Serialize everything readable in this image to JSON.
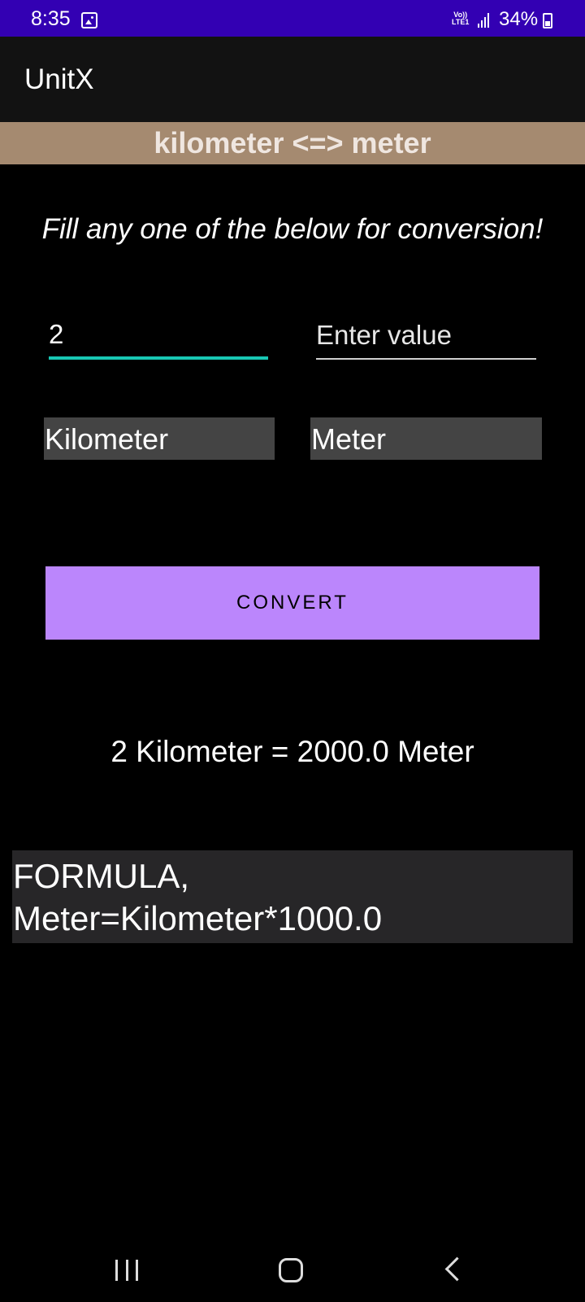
{
  "status_bar": {
    "time": "8:35",
    "network_label": "Vo)) LTE1",
    "battery": "34%"
  },
  "app_bar": {
    "title": "UnitX"
  },
  "conversion": {
    "header": "kilometer <=> meter",
    "instruction": "Fill any one of the below for conversion!",
    "input_left_value": "2",
    "input_right_placeholder": "Enter value",
    "unit_left": "Kilometer",
    "unit_right": "Meter",
    "convert_label": "CONVERT",
    "result_text": "2 Kilometer = 2000.0 Meter",
    "formula_line1": "FORMULA,",
    "formula_line2": "Meter=Kilometer*1000.0"
  },
  "colors": {
    "status_bar": "#3300b3",
    "app_bar": "#121212",
    "banner": "#a58a70",
    "accent_teal": "#18c7b4",
    "convert_button": "#bb86fc"
  },
  "icons": {
    "status": [
      "image-icon",
      "volte-icon",
      "signal-icon",
      "battery-icon"
    ],
    "nav": [
      "recents-icon",
      "home-icon",
      "back-icon"
    ]
  }
}
